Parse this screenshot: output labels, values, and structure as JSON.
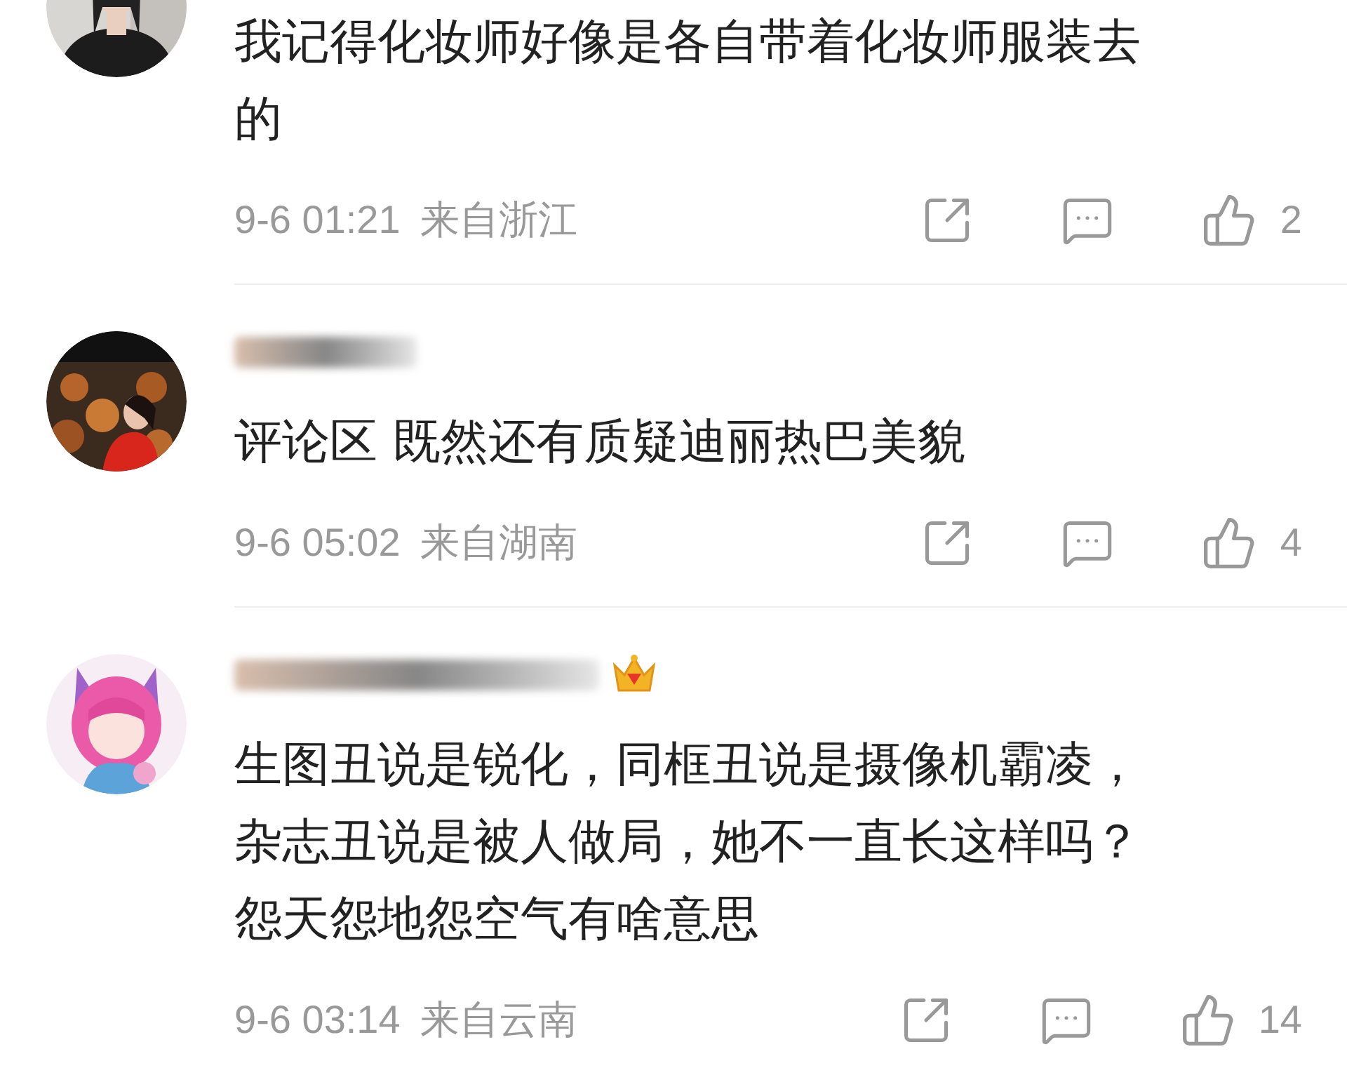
{
  "comments": [
    {
      "avatar": {
        "kind": "picture"
      },
      "username_obscured": false,
      "vip_badge": false,
      "text_lines": [
        "我记得化妆师好像是各自带着化妆师服装去",
        "的"
      ],
      "time": "9-6 01:21",
      "location": "来自浙江",
      "likes": "2"
    },
    {
      "avatar": {
        "kind": "picture"
      },
      "username_obscured": true,
      "vip_badge": false,
      "text_lines": [
        "评论区 既然还有质疑迪丽热巴美貌"
      ],
      "time": "9-6 05:02",
      "location": "来自湖南",
      "likes": "4"
    },
    {
      "avatar": {
        "kind": "picture"
      },
      "username_obscured": true,
      "vip_badge": true,
      "text_lines": [
        "生图丑说是锐化，同框丑说是摄像机霸凌，",
        "杂志丑说是被人做局，她不一直长这样吗？",
        "怨天怨地怨空气有啥意思"
      ],
      "time": "9-6 03:14",
      "location": "来自云南",
      "likes": "14"
    }
  ]
}
